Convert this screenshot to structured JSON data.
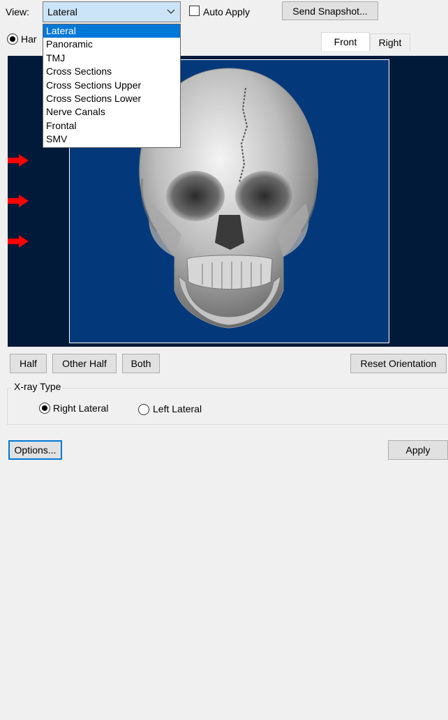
{
  "toolbar": {
    "view_label": "View:",
    "view_selected": "Lateral",
    "auto_apply_label": "Auto Apply",
    "auto_apply_checked": false,
    "send_snapshot_label": "Send Snapshot..."
  },
  "view_dropdown": {
    "open": true,
    "options": [
      "Lateral",
      "Panoramic",
      "TMJ",
      "Cross Sections",
      "Cross Sections Upper",
      "Cross Sections Lower",
      "Nerve Canals",
      "Frontal",
      "SMV"
    ],
    "selected_index": 0
  },
  "mode_radio": {
    "label_visible": "Har",
    "checked": true
  },
  "view_tabs": [
    "Front",
    "Right"
  ],
  "viewer": {
    "background_color": "#021a3a",
    "panel_color": "#03397a",
    "arrow_color": "#ff0000",
    "image": "3d-skull-front-render"
  },
  "half_buttons": [
    "Half",
    "Other Half",
    "Both"
  ],
  "reset_orientation_label": "Reset Orientation",
  "xray_type": {
    "title": "X-ray Type",
    "options": [
      {
        "label": "Right Lateral",
        "checked": true
      },
      {
        "label": "Left Lateral",
        "checked": false
      }
    ]
  },
  "footer": {
    "options_label": "Options...",
    "apply_label": "Apply"
  },
  "colors": {
    "window_bg": "#f0f0f0",
    "selection": "#0078d7",
    "focus_border": "#0078d7"
  }
}
